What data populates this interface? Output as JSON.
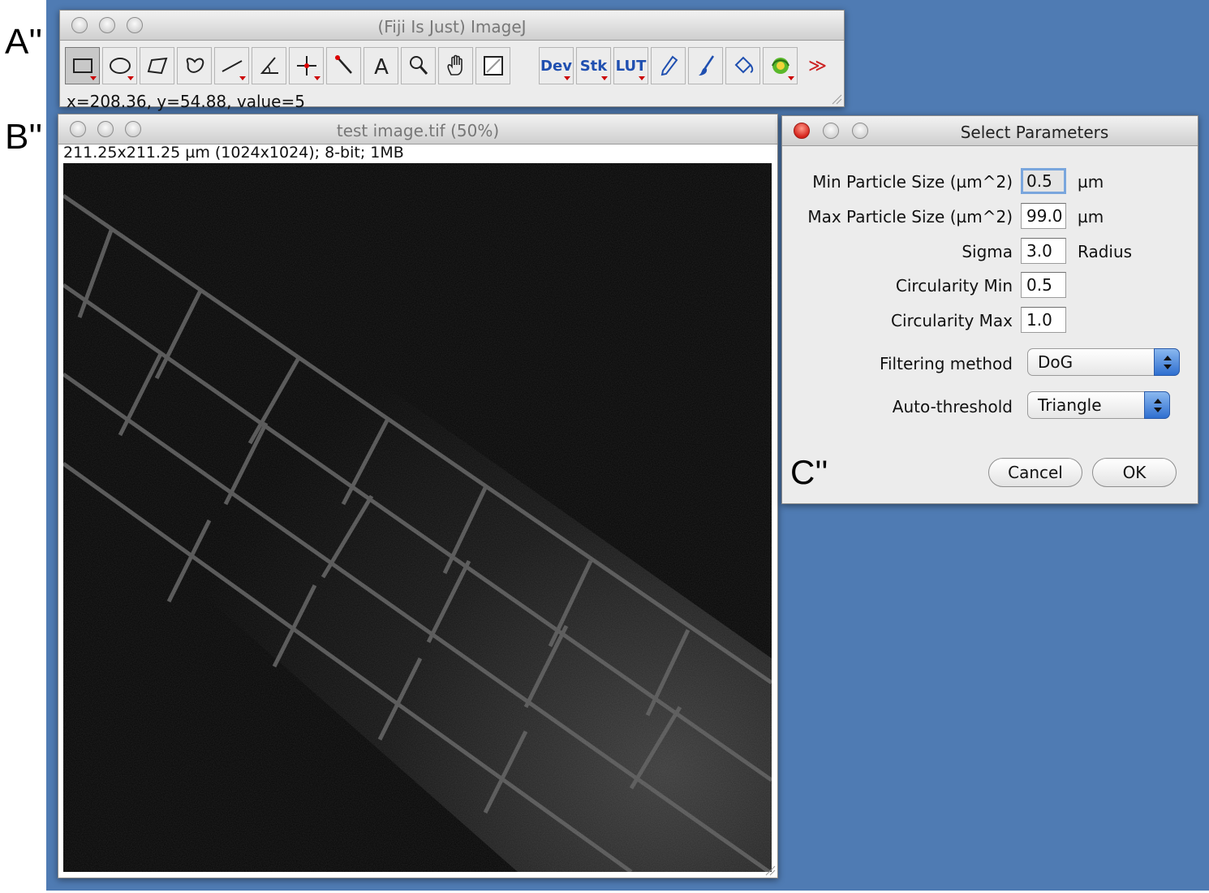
{
  "panel_labels": {
    "a": "A''",
    "b": "B''",
    "c": "C''"
  },
  "imagej_window": {
    "title": "(Fiji Is Just) ImageJ",
    "status": "x=208.36, y=54.88, value=5",
    "tools": [
      {
        "name": "rectangle-tool-icon"
      },
      {
        "name": "oval-tool-icon"
      },
      {
        "name": "polygon-tool-icon"
      },
      {
        "name": "freehand-tool-icon"
      },
      {
        "name": "line-tool-icon"
      },
      {
        "name": "angle-tool-icon"
      },
      {
        "name": "point-tool-icon"
      },
      {
        "name": "wand-tool-icon"
      },
      {
        "name": "text-tool-icon"
      },
      {
        "name": "magnifier-tool-icon"
      },
      {
        "name": "hand-tool-icon"
      },
      {
        "name": "color-picker-tool-icon"
      },
      {
        "name": "dev-menu",
        "label": "Dev"
      },
      {
        "name": "stk-menu",
        "label": "Stk"
      },
      {
        "name": "lut-menu",
        "label": "LUT"
      },
      {
        "name": "pencil-tool-icon"
      },
      {
        "name": "brush-tool-icon"
      },
      {
        "name": "flood-fill-tool-icon"
      },
      {
        "name": "plugin-tool-icon"
      },
      {
        "name": "more-tools-icon",
        "label": "≫"
      }
    ]
  },
  "image_window": {
    "title": "test image.tif (50%)",
    "info": "211.25x211.25 µm (1024x1024); 8-bit; 1MB"
  },
  "dialog": {
    "title": "Select Parameters",
    "min_particle_label": "Min Particle Size (µm^2)",
    "min_particle_value": "0.5",
    "min_particle_unit": "µm",
    "max_particle_label": "Max Particle Size (µm^2)",
    "max_particle_value": "99.0",
    "max_particle_unit": "µm",
    "sigma_label": "Sigma",
    "sigma_value": "3.0",
    "sigma_unit": "Radius",
    "circ_min_label": "Circularity Min",
    "circ_min_value": "0.5",
    "circ_max_label": "Circularity Max",
    "circ_max_value": "1.0",
    "filtering_label": "Filtering method",
    "filtering_value": "DoG",
    "threshold_label": "Auto-threshold",
    "threshold_value": "Triangle",
    "cancel_label": "Cancel",
    "ok_label": "OK"
  },
  "colors": {
    "desktop": "#4f7bb3",
    "window": "#ececec",
    "close_button": "#d5231b",
    "select_stepper": "#2f6fd0"
  }
}
